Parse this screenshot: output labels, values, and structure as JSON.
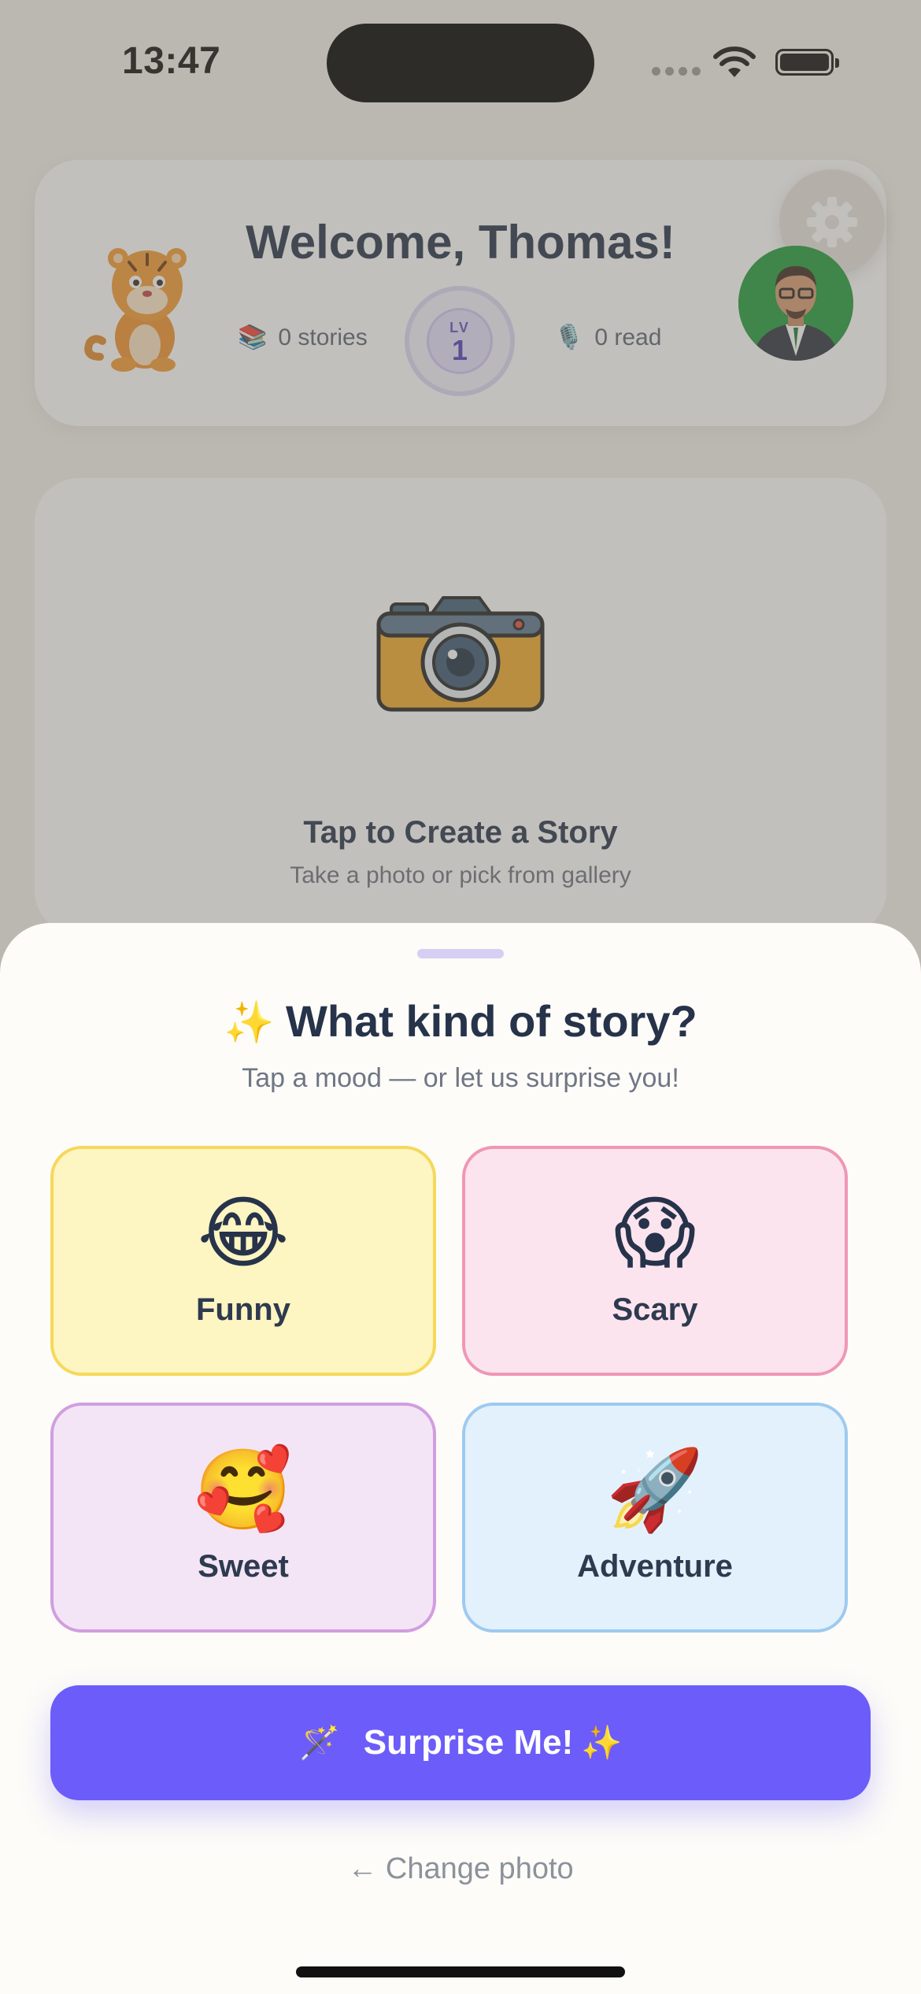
{
  "status_bar": {
    "time": "13:47"
  },
  "header": {
    "title": "Welcome, Thomas!",
    "stories_icon": "📚",
    "stories_text": "0 stories",
    "read_icon": "🎙️",
    "read_text": "0 read",
    "level_label": "LV",
    "level_value": "1"
  },
  "create_card": {
    "title": "Tap to Create a Story",
    "subtitle": "Take a photo or pick from gallery"
  },
  "sheet": {
    "title_sparkle": "✨",
    "title": "What kind of story?",
    "subtitle": "Tap a mood — or let us surprise you!",
    "moods": [
      {
        "emoji": "😂",
        "label": "Funny"
      },
      {
        "emoji": "😱",
        "label": "Scary"
      },
      {
        "emoji": "🥰",
        "label": "Sweet"
      },
      {
        "emoji": "🚀",
        "label": "Adventure"
      }
    ],
    "surprise_wand": "🪄",
    "surprise_label": "Surprise Me!",
    "surprise_sparkle": "✨",
    "change_photo": "← Change photo"
  },
  "colors": {
    "accent": "#6c5cf9",
    "funny_bg": "#fdf5c2",
    "scary_bg": "#fce4ef",
    "sweet_bg": "#f3e5f6",
    "adventure_bg": "#e3f1fd"
  }
}
